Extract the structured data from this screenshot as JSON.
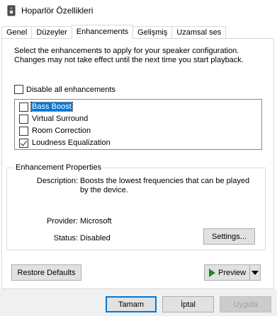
{
  "window": {
    "title": "Hoparlör Özellikleri"
  },
  "tabs": [
    {
      "label": "Genel"
    },
    {
      "label": "Düzeyler"
    },
    {
      "label": "Enhancements"
    },
    {
      "label": "Gelişmiş"
    },
    {
      "label": "Uzamsal ses"
    }
  ],
  "active_tab": "Enhancements",
  "intro_text": "Select the enhancements to apply for your speaker configuration. Changes may not take effect until the next time you start playback.",
  "disable_all": {
    "label": "Disable all enhancements",
    "checked": false
  },
  "enhancements": [
    {
      "label": "Bass Boost",
      "checked": false,
      "selected": true
    },
    {
      "label": "Virtual Surround",
      "checked": false,
      "selected": false
    },
    {
      "label": "Room Correction",
      "checked": false,
      "selected": false
    },
    {
      "label": "Loudness Equalization",
      "checked": true,
      "selected": false
    }
  ],
  "properties": {
    "legend": "Enhancement Properties",
    "description_label": "Description:",
    "description_value": "Boosts the lowest frequencies that can be played by the device.",
    "provider_label": "Provider:",
    "provider_value": "Microsoft",
    "status_label": "Status:",
    "status_value": "Disabled",
    "settings_button": "Settings..."
  },
  "restore_defaults_button": "Restore Defaults",
  "preview_button": "Preview",
  "footer": {
    "ok": "Tamam",
    "cancel": "İptal",
    "apply": "Uygula"
  }
}
